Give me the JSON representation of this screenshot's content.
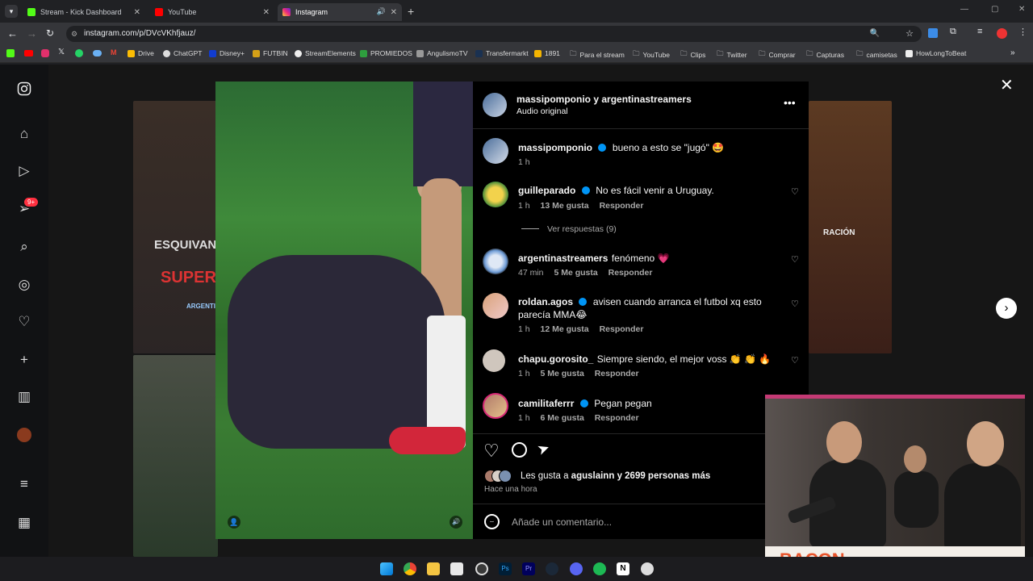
{
  "browser": {
    "tabs": [
      {
        "title": "Stream - Kick Dashboard",
        "color": "#53fc18"
      },
      {
        "title": "YouTube",
        "color": "#ff0000"
      },
      {
        "title": "Instagram",
        "color": "#e1306c"
      }
    ],
    "url": "instagram.com/p/DVcVKhfjauz/",
    "bookmarks": [
      "Drive",
      "ChatGPT",
      "Disney+",
      "FUTBIN",
      "StreamElements",
      "PROMIEDOS",
      "AngulismoTV",
      "Transfermarkt",
      "1891",
      "Para el stream",
      "YouTube",
      "Clips",
      "Twitter",
      "Comprar",
      "Capturas",
      "camisetas",
      "HowLongToBeat"
    ]
  },
  "post": {
    "header_users": "massipomponio y argentinastreamers",
    "audio": "Audio original",
    "caption_user": "massipomponio",
    "caption_text": "bueno a esto se \"jugó\" 🤩",
    "caption_time": "1 h",
    "comments": [
      {
        "user": "guilleparado",
        "text": "No es fácil venir a Uruguay.",
        "time": "1 h",
        "likes": "13 Me gusta",
        "reply": "Responder",
        "verified": true
      },
      {
        "user": "argentinastreamers",
        "text": "fenómeno 💗",
        "time": "47 min",
        "likes": "5 Me gusta",
        "reply": "Responder",
        "verified": false
      },
      {
        "user": "roldan.agos",
        "text": "avisen cuando arranca el futbol xq esto parecía MMA😂",
        "time": "1 h",
        "likes": "12 Me gusta",
        "reply": "Responder",
        "verified": true
      },
      {
        "user": "chapu.gorosito_",
        "text": "Siempre siendo, el mejor voss 👏 👏 🔥",
        "time": "1 h",
        "likes": "5 Me gusta",
        "reply": "Responder",
        "verified": false
      },
      {
        "user": "camilitaferrr",
        "text": "Pegan pegan",
        "time": "1 h",
        "likes": "6 Me gusta",
        "reply": "Responder",
        "verified": true
      }
    ],
    "view_replies": "Ver respuestas (9)",
    "likes_prefix": "Les gusta a",
    "likes_user": "aguslainn",
    "likes_suffix": "y 2699 personas más",
    "posted": "Hace una hora",
    "comment_placeholder": "Añade un comentario...",
    "notifications_badge": "9+"
  },
  "background": {
    "card_text_1": "ESQUIVAN",
    "card_text_2": "SUPER",
    "card_text_3": "ARGENTIN",
    "card_text_4": "RACIÓN"
  },
  "overlay": {
    "brand": "BACON"
  }
}
